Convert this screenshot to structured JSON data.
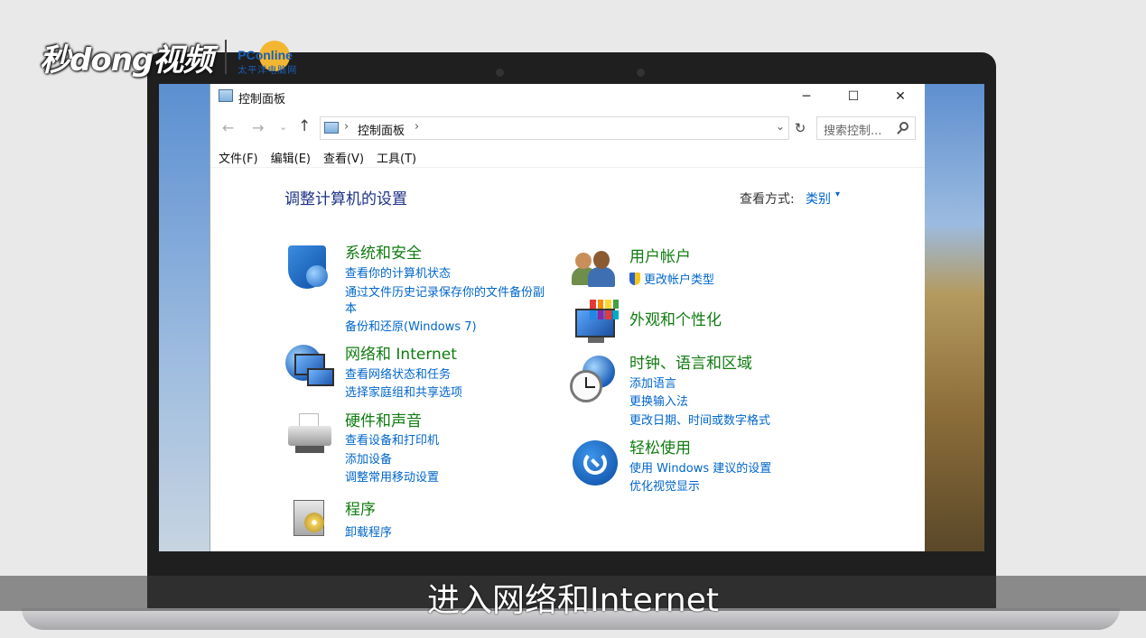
{
  "watermark": {
    "brand": "秒dong视频",
    "logo_text": "PConline",
    "logo_sub": "太平洋电脑网"
  },
  "window": {
    "title": "控制面板",
    "controls": {
      "minimize": "─",
      "maximize": "☐",
      "close": "✕"
    }
  },
  "nav": {
    "back": "←",
    "forward": "→",
    "recent": "⌄",
    "up": "↑",
    "address": "控制面板",
    "separator": "›",
    "dropdown": "⌄",
    "refresh": "↻",
    "search_placeholder": "搜索控制..."
  },
  "menu": [
    "文件(F)",
    "编辑(E)",
    "查看(V)",
    "工具(T)"
  ],
  "content": {
    "heading": "调整计算机的设置",
    "view_by_label": "查看方式:",
    "view_by_value": "类别",
    "view_by_caret": "▾",
    "left": [
      {
        "title": "系统和安全",
        "icon": "shield-icon",
        "links": [
          "查看你的计算机状态",
          "通过文件历史记录保存你的文件备份副",
          "本",
          "备份和还原(Windows 7)"
        ]
      },
      {
        "title": "网络和 Internet",
        "icon": "network-icon",
        "links": [
          "查看网络状态和任务",
          "选择家庭组和共享选项"
        ]
      },
      {
        "title": "硬件和声音",
        "icon": "printer-icon",
        "links": [
          "查看设备和打印机",
          "添加设备",
          "调整常用移动设置"
        ]
      },
      {
        "title": "程序",
        "icon": "program-icon",
        "links": [
          "卸载程序"
        ]
      }
    ],
    "right": [
      {
        "title": "用户帐户",
        "icon": "users-icon",
        "links": [
          "更改帐户类型"
        ]
      },
      {
        "title": "外观和个性化",
        "icon": "appearance-icon",
        "links": []
      },
      {
        "title": "时钟、语言和区域",
        "icon": "clock-icon",
        "links": [
          "添加语言",
          "更换输入法",
          "更改日期、时间或数字格式"
        ]
      },
      {
        "title": "轻松使用",
        "icon": "ease-of-access-icon",
        "links": [
          "使用 Windows 建议的设置",
          "优化视觉显示"
        ]
      }
    ]
  },
  "caption": "进入网络和Internet",
  "colors": {
    "title_green": "#107c10",
    "link_blue": "#0066cc",
    "heading_blue": "#1e3287"
  }
}
